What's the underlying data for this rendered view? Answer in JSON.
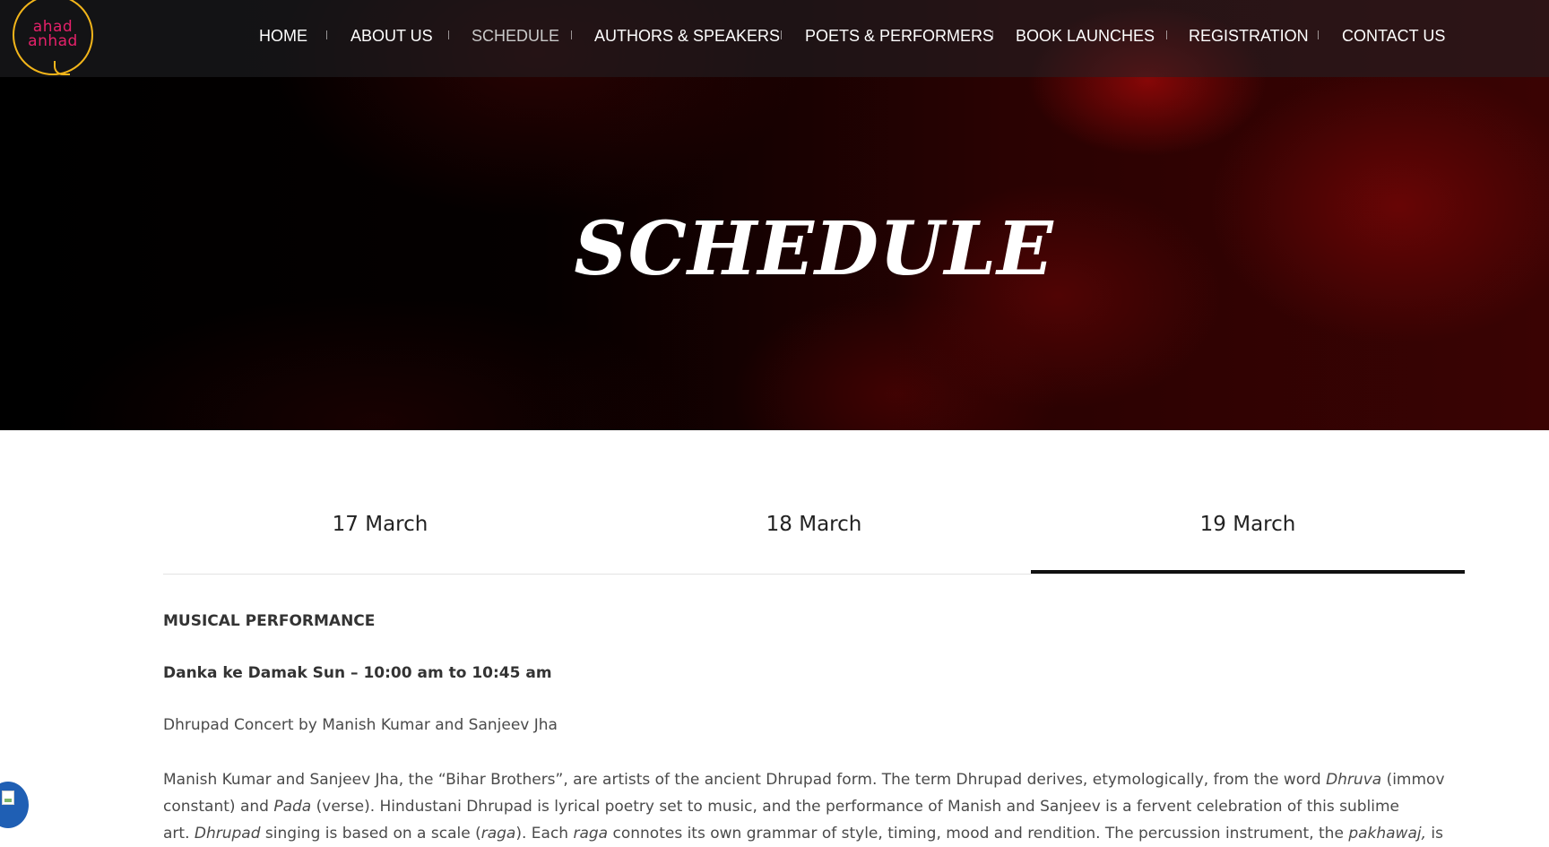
{
  "logo": {
    "line1": "ahad",
    "line2": "anhad",
    "color_text": "#e5216a",
    "color_ring": "#f2b51a"
  },
  "nav": {
    "items": [
      {
        "label": "HOME"
      },
      {
        "label": "ABOUT US"
      },
      {
        "label": "SCHEDULE"
      },
      {
        "label": "AUTHORS & SPEAKERS"
      },
      {
        "label": "POETS & PERFORMERS"
      },
      {
        "label": "BOOK LAUNCHES"
      },
      {
        "label": "REGISTRATION"
      },
      {
        "label": "CONTACT US"
      }
    ],
    "active": "SCHEDULE"
  },
  "hero": {
    "title": "SCHEDULE"
  },
  "tabs": {
    "items": [
      {
        "label": "17 March"
      },
      {
        "label": "18 March"
      },
      {
        "label": "19 March"
      }
    ],
    "active": "19 March"
  },
  "content": {
    "section_heading": "MUSICAL PERFORMANCE",
    "event_title": "Danka ke Damak Sun – 10:00 am to 10:45 am",
    "event_subtitle": "Dhrupad Concert by Manish Kumar and Sanjeev Jha",
    "description": {
      "l1a": "Manish Kumar and Sanjeev Jha, the “Bihar Brothers”, are artists of the ancient Dhrupad form. The term Dhrupad derives, etymologically, from the word ",
      "l1b": "Dhruva",
      "l1c": " (immoveable or",
      "l2a": "constant) and ",
      "l2b": "Pada",
      "l2c": " (verse). Hindustani Dhrupad is lyrical poetry set to music, and the performance of Manish and Sanjeev is a fervent celebration of this sublime",
      "l3a": "art. ",
      "l3b": "Dhrupad",
      "l3c": " singing is based on a scale (",
      "l3d": "raga",
      "l3e": "). Each ",
      "l3f": "raga",
      "l3g": " connotes its own grammar of style, timing, mood and rendition. The percussion instrument, the ",
      "l3h": "pakhawaj,",
      "l3i": " is"
    }
  },
  "colors": {
    "accent_dark": "#111111",
    "float_button": "#1f5fb4"
  }
}
